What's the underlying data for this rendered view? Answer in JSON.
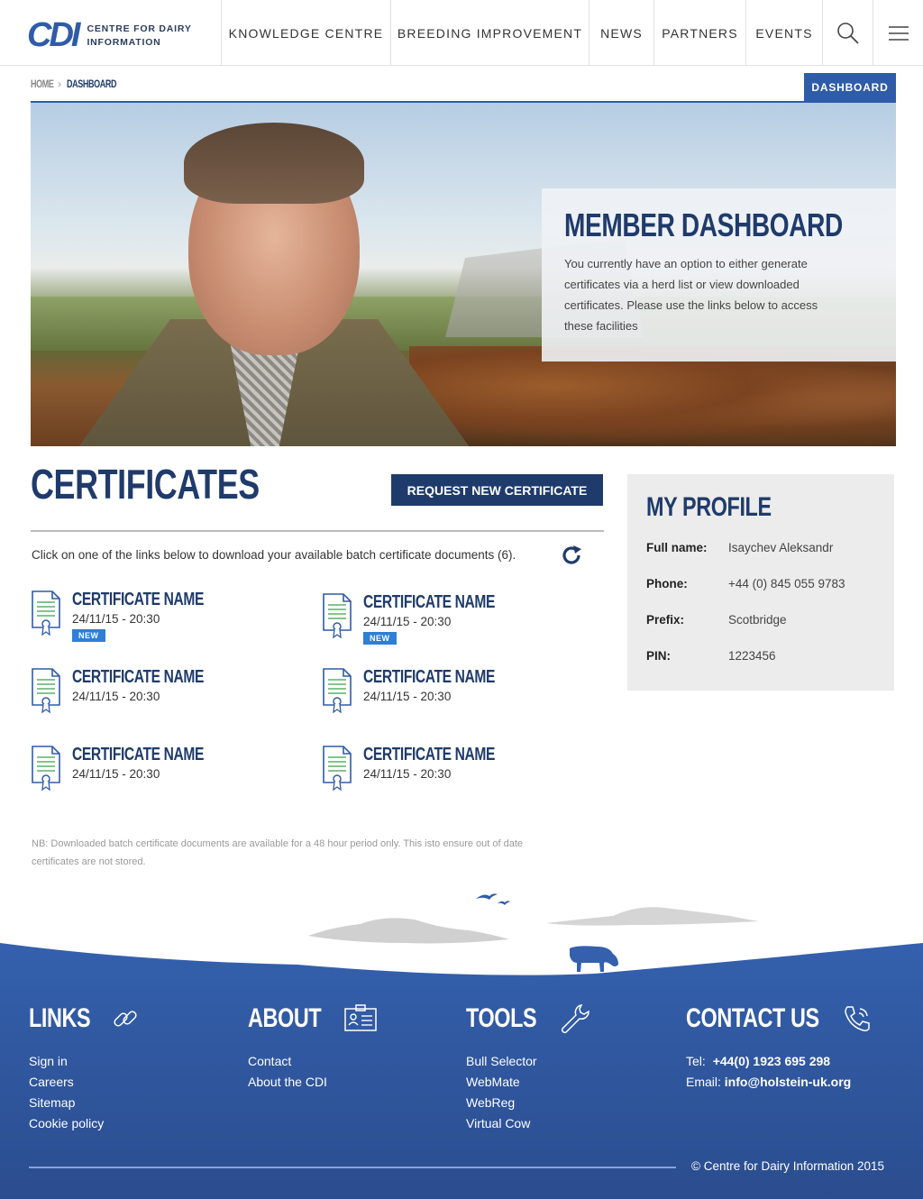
{
  "header": {
    "logo_mark": "CDI",
    "logo_line1": "CENTRE FOR DAIRY",
    "logo_line2": "INFORMATION",
    "nav": [
      "KNOWLEDGE CENTRE",
      "BREEDING IMPROVEMENT",
      "NEWS",
      "PARTNERS",
      "EVENTS"
    ],
    "icons": [
      "search-icon",
      "menu-icon"
    ]
  },
  "breadcrumb": {
    "home": "HOME",
    "separator": "›",
    "current": "DASHBOARD"
  },
  "dashboard_tab": "DASHBOARD",
  "hero": {
    "title": "MEMBER DASHBOARD",
    "text": "You currently have an option to either generate certificates via a herd list or view downloaded certificates. Please use the links below to access these facilities"
  },
  "certificates": {
    "title": "CERTIFICATES",
    "request_button": "REQUEST NEW CERTIFICATE",
    "intro": "Click on one of the links below to download your available batch certificate documents (6).",
    "items": [
      {
        "name": "CERTIFICATE NAME",
        "date": "24/11/15 - 20:30",
        "badge": "NEW"
      },
      {
        "name": "CERTIFICATE NAME",
        "date": "24/11/15 - 20:30",
        "badge": "NEW"
      },
      {
        "name": "CERTIFICATE NAME",
        "date": "24/11/15 - 20:30",
        "badge": ""
      },
      {
        "name": "CERTIFICATE NAME",
        "date": "24/11/15 - 20:30",
        "badge": ""
      },
      {
        "name": "CERTIFICATE NAME",
        "date": "24/11/15 - 20:30",
        "badge": ""
      },
      {
        "name": "CERTIFICATE NAME",
        "date": "24/11/15 - 20:30",
        "badge": ""
      }
    ],
    "note": "NB: Downloaded batch certificate documents are available for a 48 hour period only. This isto ensure out of date certificates are not stored."
  },
  "profile": {
    "title": "MY PROFILE",
    "rows": [
      {
        "label": "Full name:",
        "value": "Isaychev Aleksandr"
      },
      {
        "label": "Phone:",
        "value": "+44 (0) 845 055 9783"
      },
      {
        "label": "Prefix:",
        "value": "Scotbridge"
      },
      {
        "label": "PIN:",
        "value": "1223456"
      }
    ]
  },
  "footer": {
    "links": {
      "title": "LINKS",
      "items": [
        "Sign in",
        "Careers",
        "Sitemap",
        "Cookie policy"
      ]
    },
    "about": {
      "title": "ABOUT",
      "items": [
        "Contact",
        "About the CDI"
      ]
    },
    "tools": {
      "title": "TOOLS",
      "items": [
        "Bull Selector",
        "WebMate",
        "WebReg",
        "Virtual Cow"
      ]
    },
    "contact": {
      "title": "CONTACT US",
      "tel_label": "Tel:",
      "tel_value": "+44(0) 1923 695 298",
      "email_label": "Email:",
      "email_value": "info@holstein-uk.org"
    },
    "copyright": "© Centre for Dairy Information 2015"
  },
  "colors": {
    "brand_blue": "#2f5ca8",
    "navy": "#1f3b6b",
    "badge_blue": "#2f7ed8"
  }
}
